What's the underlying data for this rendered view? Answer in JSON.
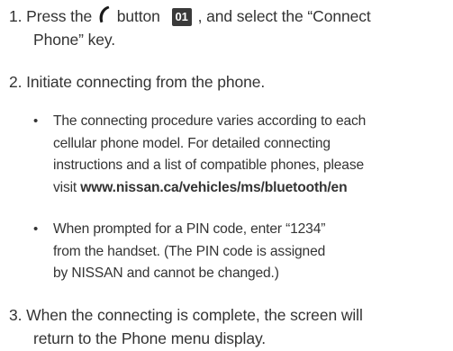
{
  "steps": [
    {
      "line1_prefix": "1.  Press the",
      "icon": "phone-handset-icon",
      "line1_mid": "button",
      "badge": "01",
      "line1_suffix": ", and select the “Connect",
      "line2": "Phone” key."
    },
    {
      "line1": "2.  Initiate connecting from the phone."
    },
    {
      "line1": "3.  When the connecting is complete, the screen will",
      "line2": "return to the Phone menu display."
    }
  ],
  "bullets": [
    {
      "marker": "•",
      "line1": "The connecting procedure varies according to each",
      "line2": "cellular phone model. For detailed connecting",
      "line3": "instructions and a list of compatible phones, please",
      "line4_prefix": "visit",
      "url": "www.nissan.ca/vehicles/ms/bluetooth/en"
    },
    {
      "marker": "•",
      "line1": "When prompted for a PIN code, enter “1234”",
      "line2": "from the handset. (The PIN code is assigned",
      "line3": "by NISSAN and cannot be changed.)"
    }
  ]
}
